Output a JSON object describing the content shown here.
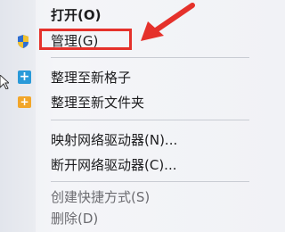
{
  "context_menu": {
    "items": [
      {
        "label": "打开(O)",
        "style": "bold"
      },
      {
        "label": "管理(G)",
        "icon": "shield-icon",
        "highlighted": true
      },
      {
        "label": "整理至新格子",
        "icon": "plus-blue-icon"
      },
      {
        "label": "整理至新文件夹",
        "icon": "plus-folder-icon"
      },
      {
        "label": "映射网络驱动器(N)..."
      },
      {
        "label": "断开网络驱动器(C)..."
      },
      {
        "label": "创建快捷方式(S)",
        "style": "dim"
      },
      {
        "label": "删除(D)",
        "style": "dim"
      }
    ]
  },
  "annotation": {
    "arrow_color": "#e5312b",
    "box_color": "#e5312b"
  }
}
